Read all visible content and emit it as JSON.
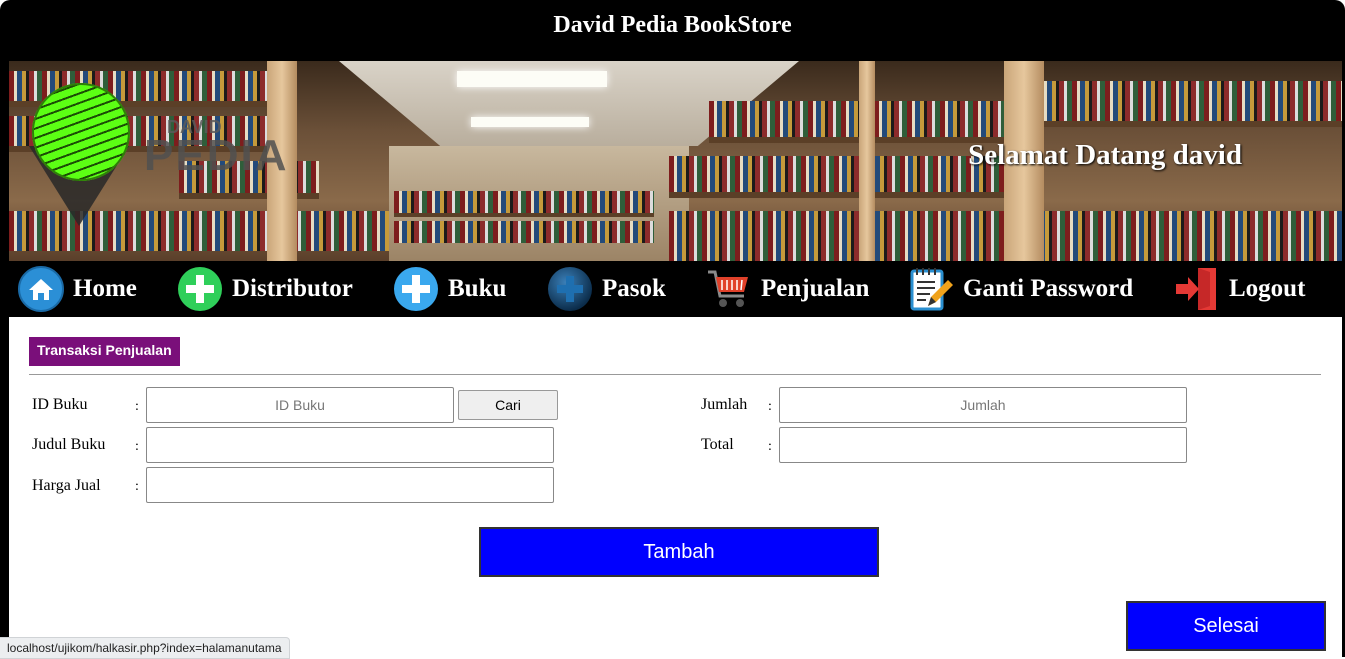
{
  "app": {
    "title": "David Pedia BookStore"
  },
  "banner": {
    "logo_small": "DAVID",
    "logo_big": "PEDIA",
    "welcome": "Selamat Datang david"
  },
  "nav": {
    "items": [
      {
        "label": "Home",
        "icon": "home-icon"
      },
      {
        "label": "Distributor",
        "icon": "plus-green-icon"
      },
      {
        "label": "Buku",
        "icon": "plus-blue-icon"
      },
      {
        "label": "Pasok",
        "icon": "plus-dark-icon"
      },
      {
        "label": "Penjualan",
        "icon": "cart-icon"
      },
      {
        "label": "Ganti Password",
        "icon": "notepad-pencil-icon"
      },
      {
        "label": "Logout",
        "icon": "logout-icon"
      }
    ]
  },
  "form": {
    "section_title": "Transaksi Penjualan",
    "colon": ":",
    "id_buku": {
      "label": "ID Buku",
      "placeholder": "ID Buku",
      "value": ""
    },
    "cari_label": "Cari",
    "judul_buku": {
      "label": "Judul Buku",
      "value": ""
    },
    "harga_jual": {
      "label": "Harga Jual",
      "value": ""
    },
    "jumlah": {
      "label": "Jumlah",
      "placeholder": "Jumlah",
      "value": ""
    },
    "total": {
      "label": "Total",
      "value": ""
    },
    "tambah_label": "Tambah",
    "selesai_label": "Selesai"
  },
  "status_bar": {
    "url": "localhost/ujikom/halkasir.php?index=halamanutama"
  },
  "colors": {
    "header_bg": "#000000",
    "section_tag": "#7a0f7a",
    "primary_button": "#0000ff"
  }
}
